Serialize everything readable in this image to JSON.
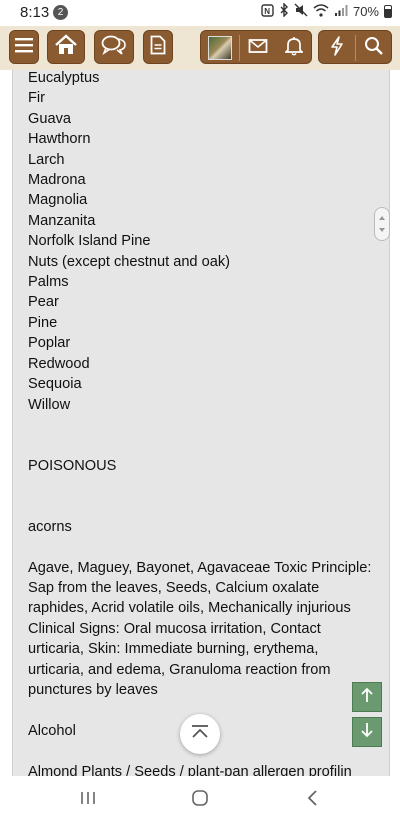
{
  "status_bar": {
    "time": "8:13",
    "notification_count": "2",
    "battery": "70%"
  },
  "toolbar": {
    "buttons": [
      "menu-icon",
      "home-icon",
      "chat-icon",
      "document-icon",
      "avatar",
      "mail-icon",
      "bell-icon",
      "lightning-icon",
      "search-icon"
    ]
  },
  "content": {
    "lines": [
      "Eucalyptus",
      "Fir",
      "Guava",
      "Hawthorn",
      "Larch",
      "Madrona",
      "Magnolia",
      "Manzanita",
      "Norfolk Island Pine",
      "Nuts (except chestnut and oak)",
      "Palms",
      "Pear",
      "Pine",
      "Poplar",
      "Redwood",
      "Sequoia",
      "Willow",
      "",
      "",
      "POISONOUS",
      "",
      "",
      "acorns",
      "",
      "Agave, Maguey, Bayonet, Agavaceae Toxic Principle: Sap from the leaves, Seeds, Calcium oxalate raphides, Acrid volatile oils, Mechanically injurious Clinical Signs: Oral mucosa irritation, Contact urticaria, Skin: Immediate burning, erythema, urticaria, and edema, Granuloma reaction from punctures by leaves",
      "",
      "Alcohol",
      "",
      "Almond Plants / Seeds / plant-pan allergen profilin"
    ]
  },
  "colors": {
    "toolbar_bg": "#eee5d2",
    "toolbar_button": "#8a5a30",
    "content_bg": "#e6e6e6",
    "fab_green": "#6c9a70"
  }
}
